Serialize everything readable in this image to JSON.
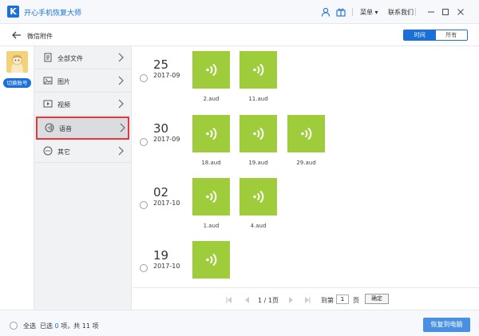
{
  "app": {
    "title": "开心手机恢复大师",
    "logo_letter": "K"
  },
  "titlebar": {
    "menu_label": "菜单",
    "contact_label": "联系我们"
  },
  "subbar": {
    "title": "微信附件",
    "tabs": [
      {
        "label": "时间",
        "active": true
      },
      {
        "label": "所有",
        "active": false
      }
    ]
  },
  "account": {
    "switch_label": "切换账号"
  },
  "categories": [
    {
      "label": "全部文件",
      "icon": "document-icon",
      "selected": false
    },
    {
      "label": "图片",
      "icon": "image-icon",
      "selected": false
    },
    {
      "label": "视频",
      "icon": "video-icon",
      "selected": false
    },
    {
      "label": "语音",
      "icon": "audio-icon",
      "selected": true
    },
    {
      "label": "其它",
      "icon": "more-icon",
      "selected": false
    }
  ],
  "groups": [
    {
      "day": "25",
      "ym": "2017-09",
      "files": [
        "2.aud",
        "11.aud"
      ]
    },
    {
      "day": "30",
      "ym": "2017-09",
      "files": [
        "18.aud",
        "19.aud",
        "29.aud"
      ]
    },
    {
      "day": "02",
      "ym": "2017-10",
      "files": [
        "1.aud",
        "4.aud"
      ]
    },
    {
      "day": "19",
      "ym": "2017-10",
      "files": []
    }
  ],
  "pager": {
    "text": "1 / 1页",
    "goto": "到第",
    "value": "1",
    "page": "页",
    "ok": "确定"
  },
  "footer": {
    "select_all": "全选",
    "selected_prefix": "已选",
    "selected_count": "0",
    "selected_suffix": "项，共 11 项",
    "recover": "恢复到电脑"
  },
  "colors": {
    "accent": "#1a6fd8",
    "tile": "#9fcc3b",
    "highlight": "#e0393e"
  }
}
